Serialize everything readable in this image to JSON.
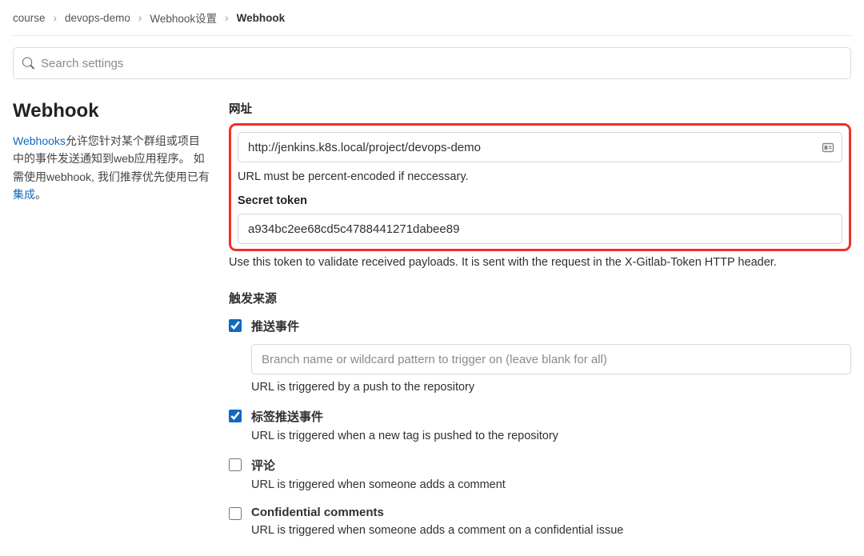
{
  "breadcrumb": {
    "items": [
      "course",
      "devops-demo",
      "Webhook设置"
    ],
    "current": "Webhook"
  },
  "search": {
    "placeholder": "Search settings"
  },
  "sidebar": {
    "title": "Webhook",
    "link1": "Webhooks",
    "desc1a": "允许您针对某个群组或项目中的事件发送通知到web应用程序。 如需使用webhook, 我们推荐优先使用已有 ",
    "link2": "集成",
    "desc1b": "。"
  },
  "form": {
    "url_label": "网址",
    "url_value": "http://jenkins.k8s.local/project/devops-demo",
    "url_help": "URL must be percent-encoded if neccessary.",
    "token_label": "Secret token",
    "token_value": "a934bc2ee68cd5c4788441271dabee89",
    "token_help": "Use this token to validate received payloads. It is sent with the request in the X-Gitlab-Token HTTP header.",
    "triggers_label": "触发来源",
    "triggers": {
      "push": {
        "label": "推送事件",
        "branch_placeholder": "Branch name or wildcard pattern to trigger on (leave blank for all)",
        "desc": "URL is triggered by a push to the repository"
      },
      "tag": {
        "label": "标签推送事件",
        "desc": "URL is triggered when a new tag is pushed to the repository"
      },
      "comment": {
        "label": "评论",
        "desc": "URL is triggered when someone adds a comment"
      },
      "conf_comment": {
        "label": "Confidential comments",
        "desc": "URL is triggered when someone adds a comment on a confidential issue"
      }
    }
  }
}
